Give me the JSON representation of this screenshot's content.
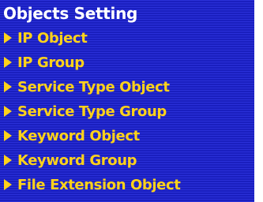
{
  "panel": {
    "title": "Objects Setting",
    "items": [
      {
        "label": "IP Object",
        "icon": "triangle-right-icon"
      },
      {
        "label": "IP Group",
        "icon": "triangle-right-icon"
      },
      {
        "label": "Service Type Object",
        "icon": "triangle-right-icon"
      },
      {
        "label": "Service Type Group",
        "icon": "triangle-right-icon"
      },
      {
        "label": "Keyword Object",
        "icon": "triangle-right-icon"
      },
      {
        "label": "Keyword Group",
        "icon": "triangle-right-icon"
      },
      {
        "label": "File Extension Object",
        "icon": "triangle-right-icon"
      }
    ]
  },
  "colors": {
    "background": "#1c22c6",
    "title_text": "#ffffff",
    "item_text": "#ffd21a",
    "arrow": "#ffd21a"
  }
}
